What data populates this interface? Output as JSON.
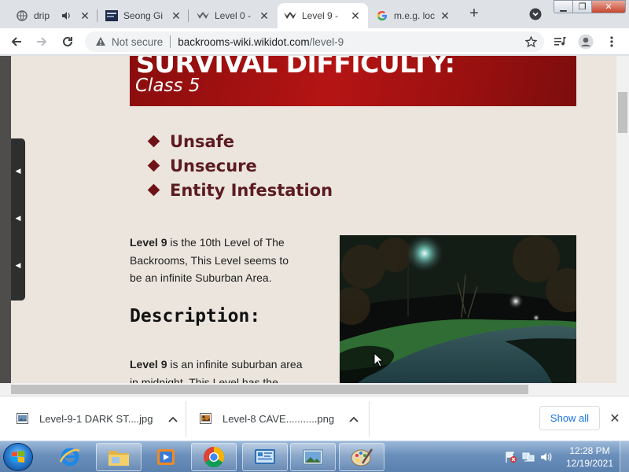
{
  "browser": {
    "tabs": [
      {
        "label": "drip",
        "icon": "chrome-globe-icon"
      },
      {
        "label": "Seong Gi",
        "icon": "video-thumbnail-icon"
      },
      {
        "label": "Level 0 -",
        "icon": "wikidot-icon"
      },
      {
        "label": "Level 9 -",
        "icon": "wikidot-icon"
      },
      {
        "label": "m.e.g. loc",
        "icon": "google-icon"
      }
    ],
    "address": {
      "security": "Not secure",
      "host": "backrooms-wiki.wikidot.com",
      "path": "/level-9"
    }
  },
  "page": {
    "banner": {
      "heading": "SURVIVAL DIFFICULTY:",
      "class_label": "Class 5"
    },
    "bullets": [
      "Unsafe",
      "Unsecure",
      "Entity Infestation"
    ],
    "intro": {
      "bold": "Level 9",
      "line1_rest": " is the 10th Level of The",
      "line2": "Backrooms, This Level seems to",
      "line3": "be an infinite Suburban Area."
    },
    "description_heading": "Description:",
    "description": {
      "bold": "Level 9",
      "line1_rest": " is an infinite suburban area",
      "line2": "in midnight. This Level has the"
    }
  },
  "downloads": [
    {
      "name": "Level-9-1 DARK ST....jpg",
      "icon": "image-file-icon"
    },
    {
      "name": "Level-8 CAVE...........png",
      "icon": "image-file-icon"
    }
  ],
  "downloads_show_all": "Show all",
  "taskbar": {
    "time": "12:28 PM",
    "date": "12/19/2021"
  },
  "colors": {
    "banner_red": "#b51414",
    "bullet_color": "#5c1b21",
    "page_bg": "#ebe5dd",
    "link_blue": "#1a73e8"
  }
}
